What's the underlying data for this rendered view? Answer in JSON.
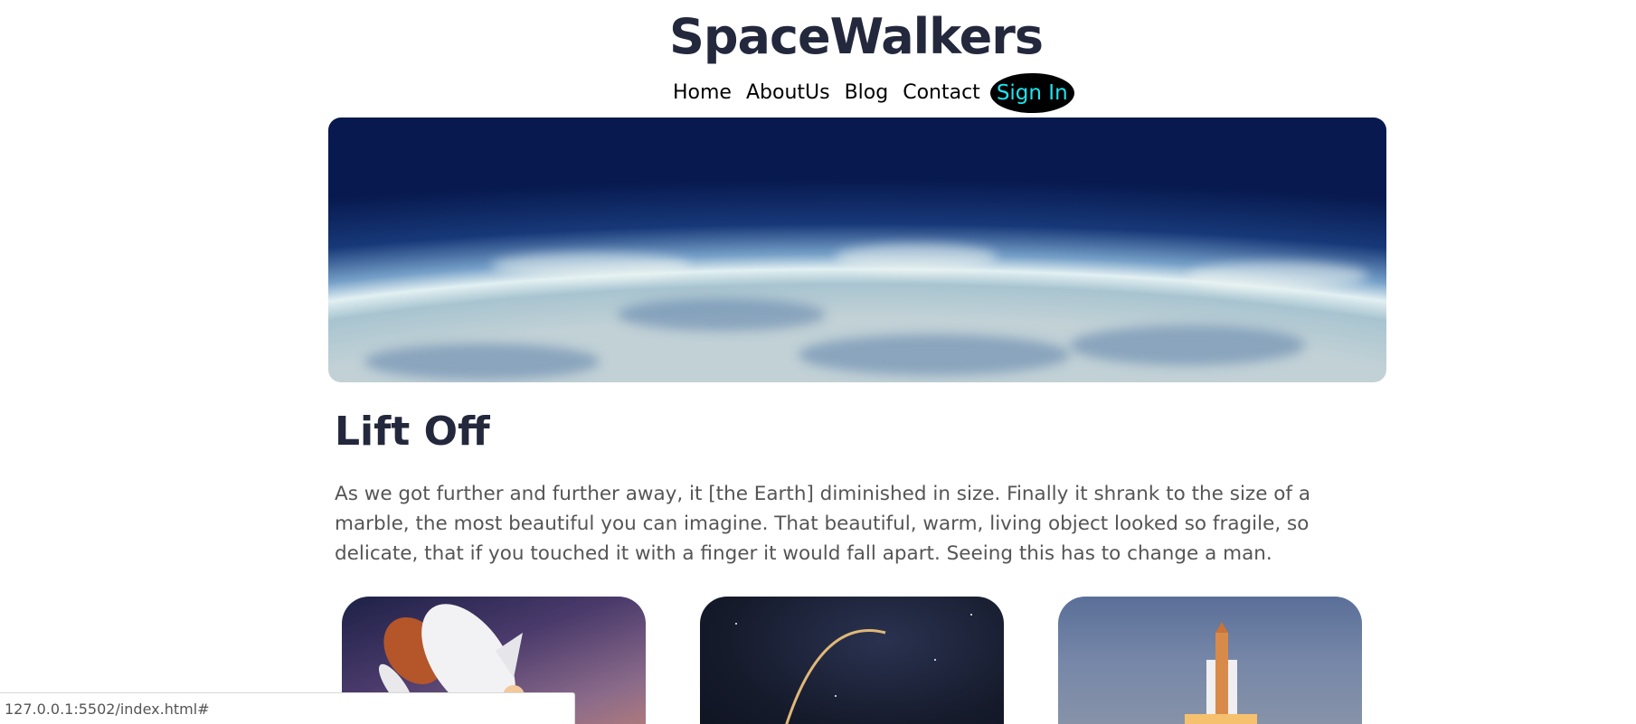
{
  "site": {
    "title": "SpaceWalkers"
  },
  "nav": {
    "items": [
      "Home",
      "AboutUs",
      "Blog",
      "Contact"
    ],
    "sign_in": "Sign In"
  },
  "colors": {
    "title": "#23283d",
    "signin_text": "#1ee3ee",
    "signin_bg": "#000000",
    "body_text": "#555555"
  },
  "main": {
    "heading": "Lift Off",
    "paragraph": "As we got further and further away, it [the Earth] diminished in size. Finally it shrank to the size of a marble, the most beautiful you can imagine. That beautiful, warm, living object looked so fragile, so delicate, that if you touched it with a finger it would fall apart. Seeing this has to change a man."
  },
  "hero": {
    "image": "earth-curvature-from-space"
  },
  "cards": [
    {
      "image": "space-shuttle-launch"
    },
    {
      "image": "rocket-trajectory-night-sky"
    },
    {
      "image": "rocket-on-launchpad"
    }
  ],
  "status_bar": {
    "url": "127.0.0.1:5502/index.html#"
  }
}
